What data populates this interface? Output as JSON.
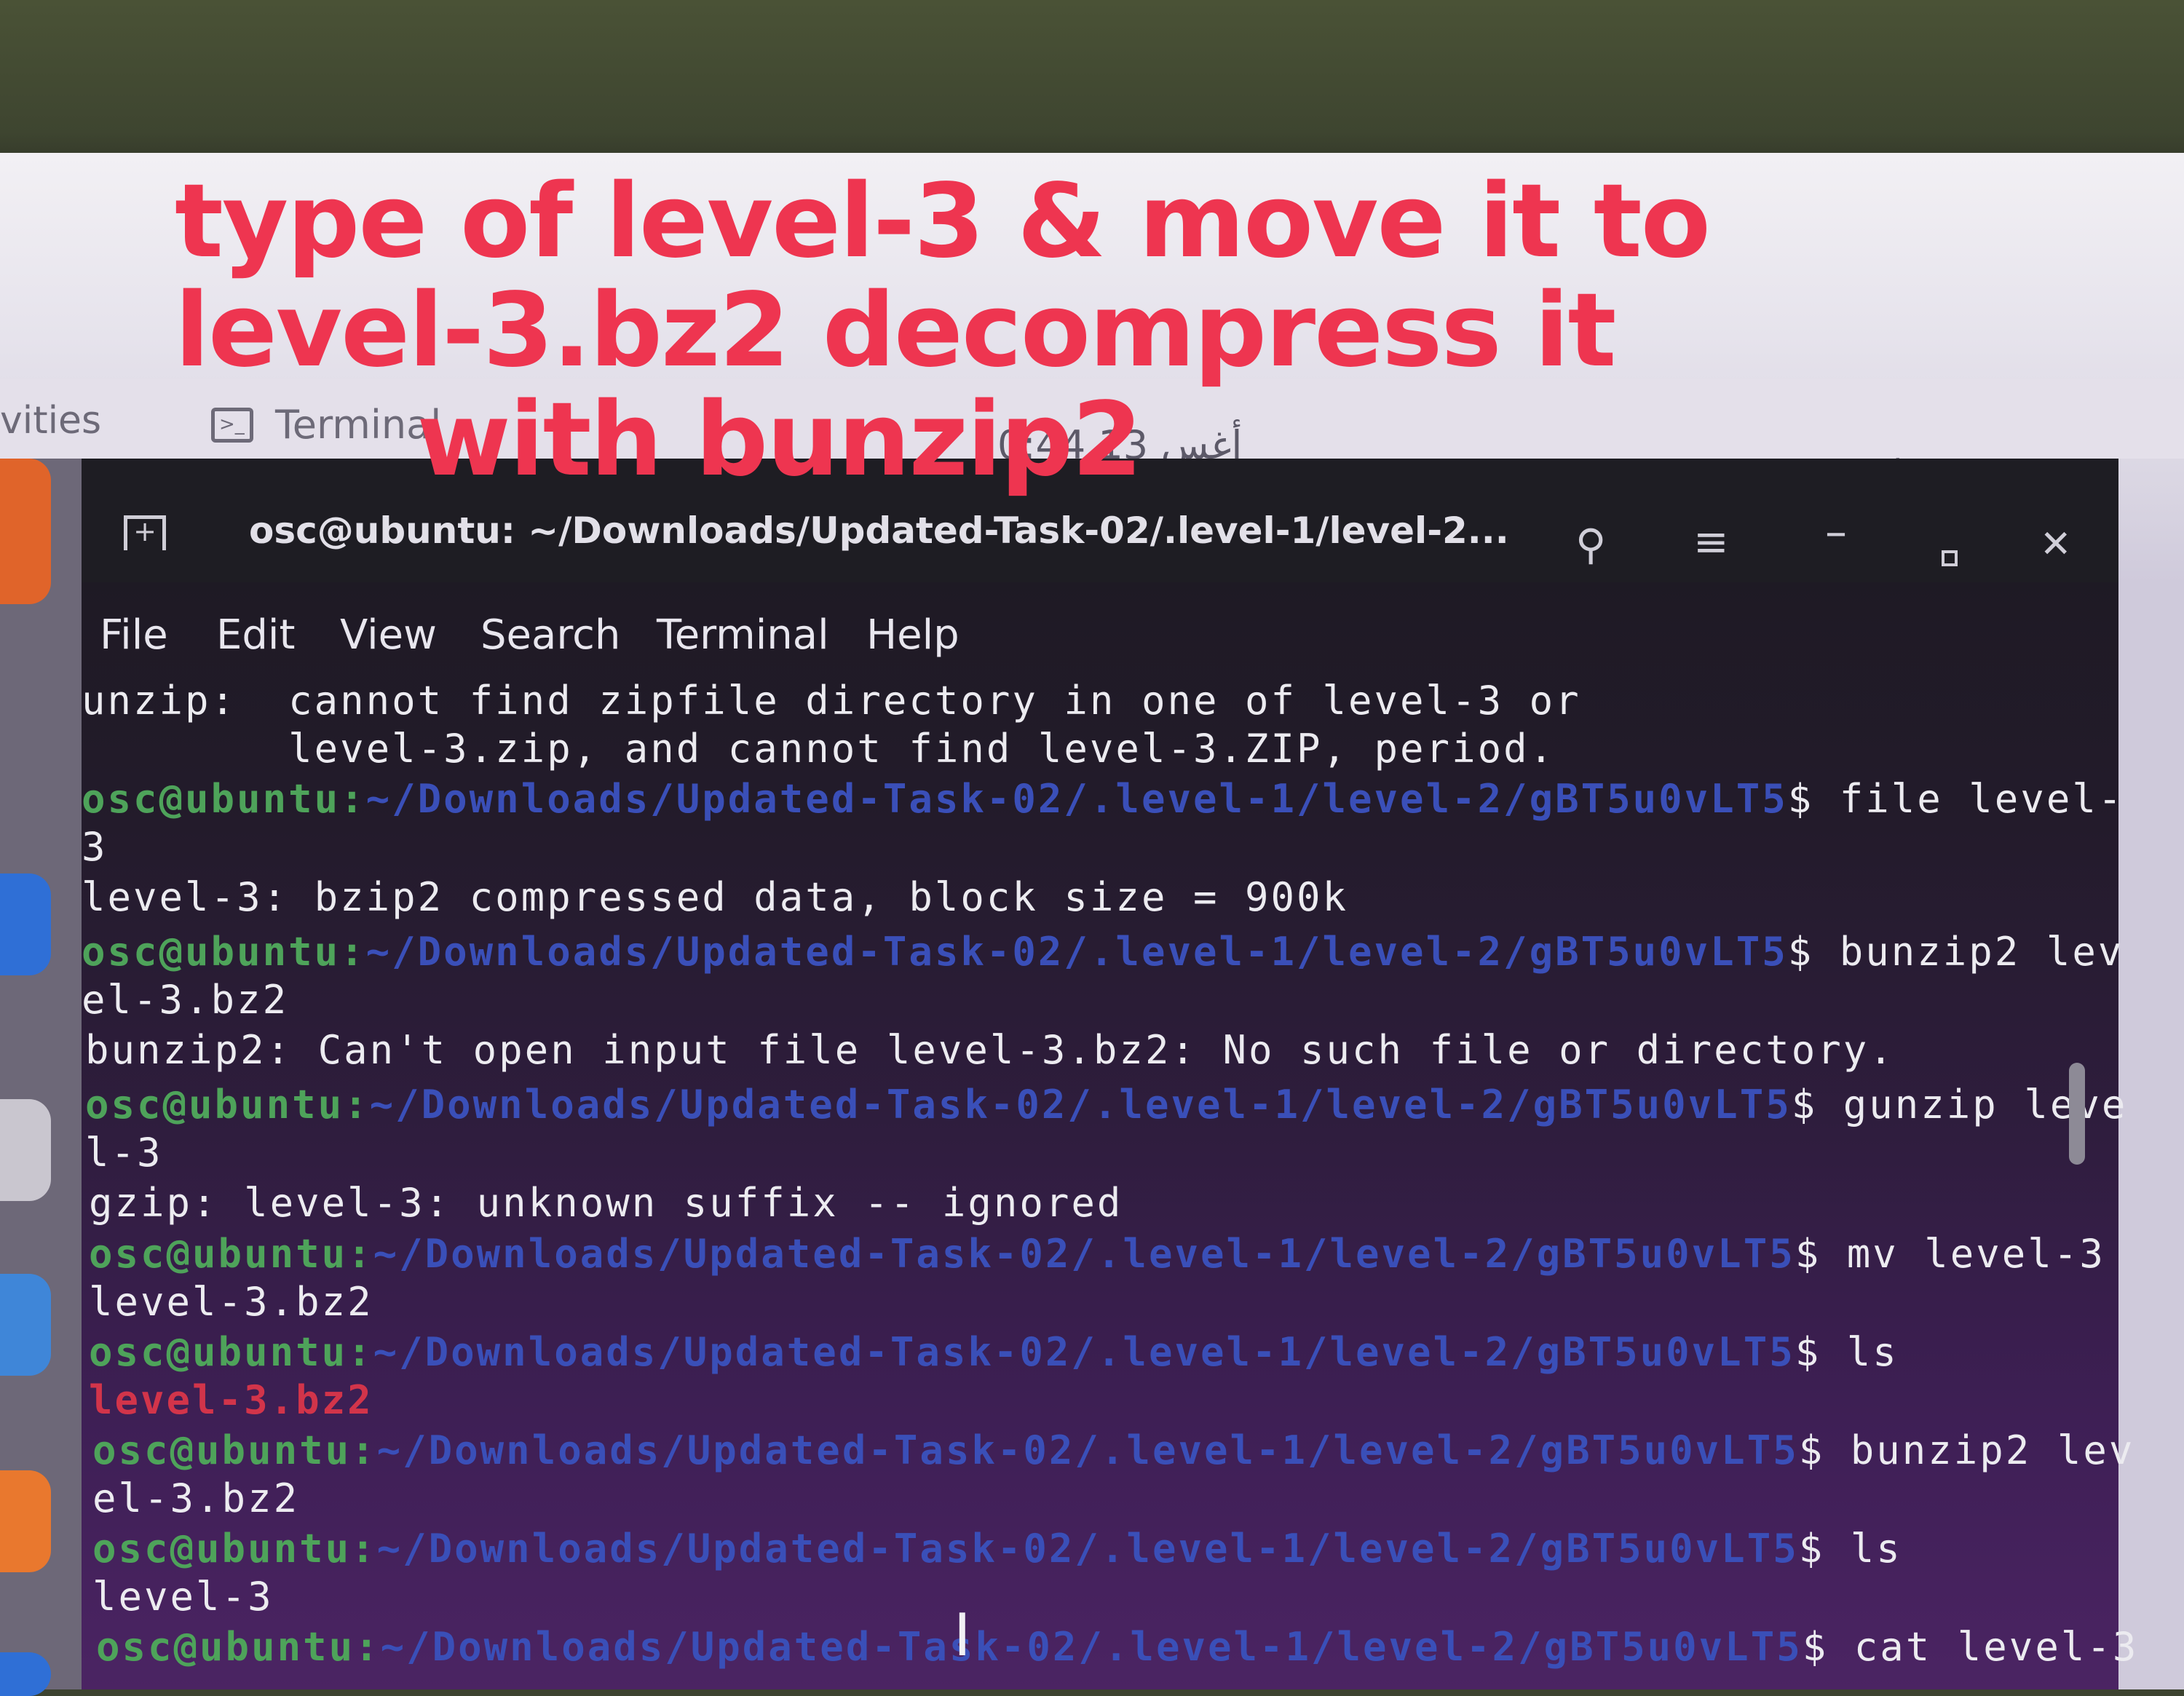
{
  "topbar": {
    "activities": "vities",
    "app_name": "Terminal",
    "clock": "0:44 13 أغس"
  },
  "annotation": {
    "line1": "type of level-3 & move it to",
    "line2": "level-3.bz2 decompress it",
    "line3": "with bunzip2"
  },
  "window": {
    "title": "osc@ubuntu: ~/Downloads/Updated-Task-02/.level-1/level-2...",
    "icons": [
      "new-tab-icon",
      "search-icon",
      "hamburger-menu-icon",
      "minimize-icon",
      "maximize-icon",
      "close-icon"
    ]
  },
  "menubar": {
    "file": "File",
    "edit": "Edit",
    "view": "View",
    "search": "Search",
    "terminal": "Terminal",
    "help": "Help"
  },
  "terminal": {
    "prompt_user": "osc@ubuntu:",
    "prompt_path": "~/Downloads/Updated-Task-02/.level-1/level-2/gBT5u0vLT5",
    "lines": {
      "l0": "unzip:  cannot find zipfile directory in one of level-3 or",
      "l1": "        level-3.zip, and cannot find level-3.ZIP, period.",
      "c2": "$ file level-",
      "l3": "3",
      "l4": "level-3: bzip2 compressed data, block size = 900k",
      "c5": "$ bunzip2 lev",
      "l6": "el-3.bz2",
      "l7": "bunzip2: Can't open input file level-3.bz2: No such file or directory.",
      "c8": "$ gunzip leve",
      "l9": "l-3",
      "l10": "gzip: level-3: unknown suffix -- ignored",
      "c11": "$ mv level-3",
      "l12": "level-3.bz2",
      "c13": "$ ls",
      "l14": "level-3.bz2",
      "c15": "$ bunzip2 lev",
      "l16": "el-3.bz2",
      "c17": "$ ls",
      "l18": "level-3",
      "c19": "$ cat level-3"
    }
  },
  "colors": {
    "prompt_user": "#4ea35a",
    "prompt_path": "#3a4fb8",
    "highlighted_file": "#d2344a",
    "annotation": "#ee3550"
  }
}
